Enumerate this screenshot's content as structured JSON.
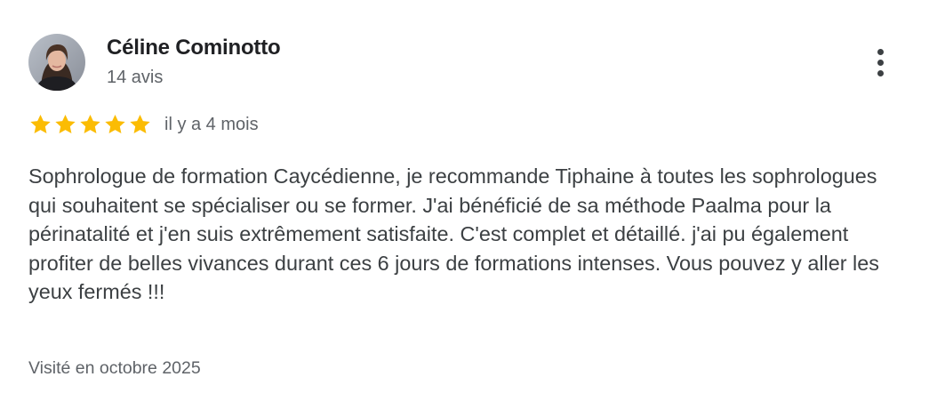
{
  "review": {
    "author": {
      "name": "Céline Cominotto",
      "review_count": "14 avis",
      "avatar_icon": "profile-photo"
    },
    "menu_icon": "more-vert-icon",
    "rating": {
      "value": 5,
      "max": 5,
      "star_color": "#fbbc04"
    },
    "date": "il y a 4 mois",
    "text": "Sophrologue de formation Caycédienne, je recommande Tiphaine à toutes les sophrologues qui souhaitent se spécialiser ou se former. J'ai bénéficié de sa méthode Paalma pour la périnatalité et j'en suis extrêmement satisfaite. C'est complet et détaillé. j'ai pu également profiter de belles vivances durant ces 6 jours de formations intenses. Vous pouvez y aller les yeux fermés !!!",
    "visit": "Visité en octobre 2025"
  }
}
